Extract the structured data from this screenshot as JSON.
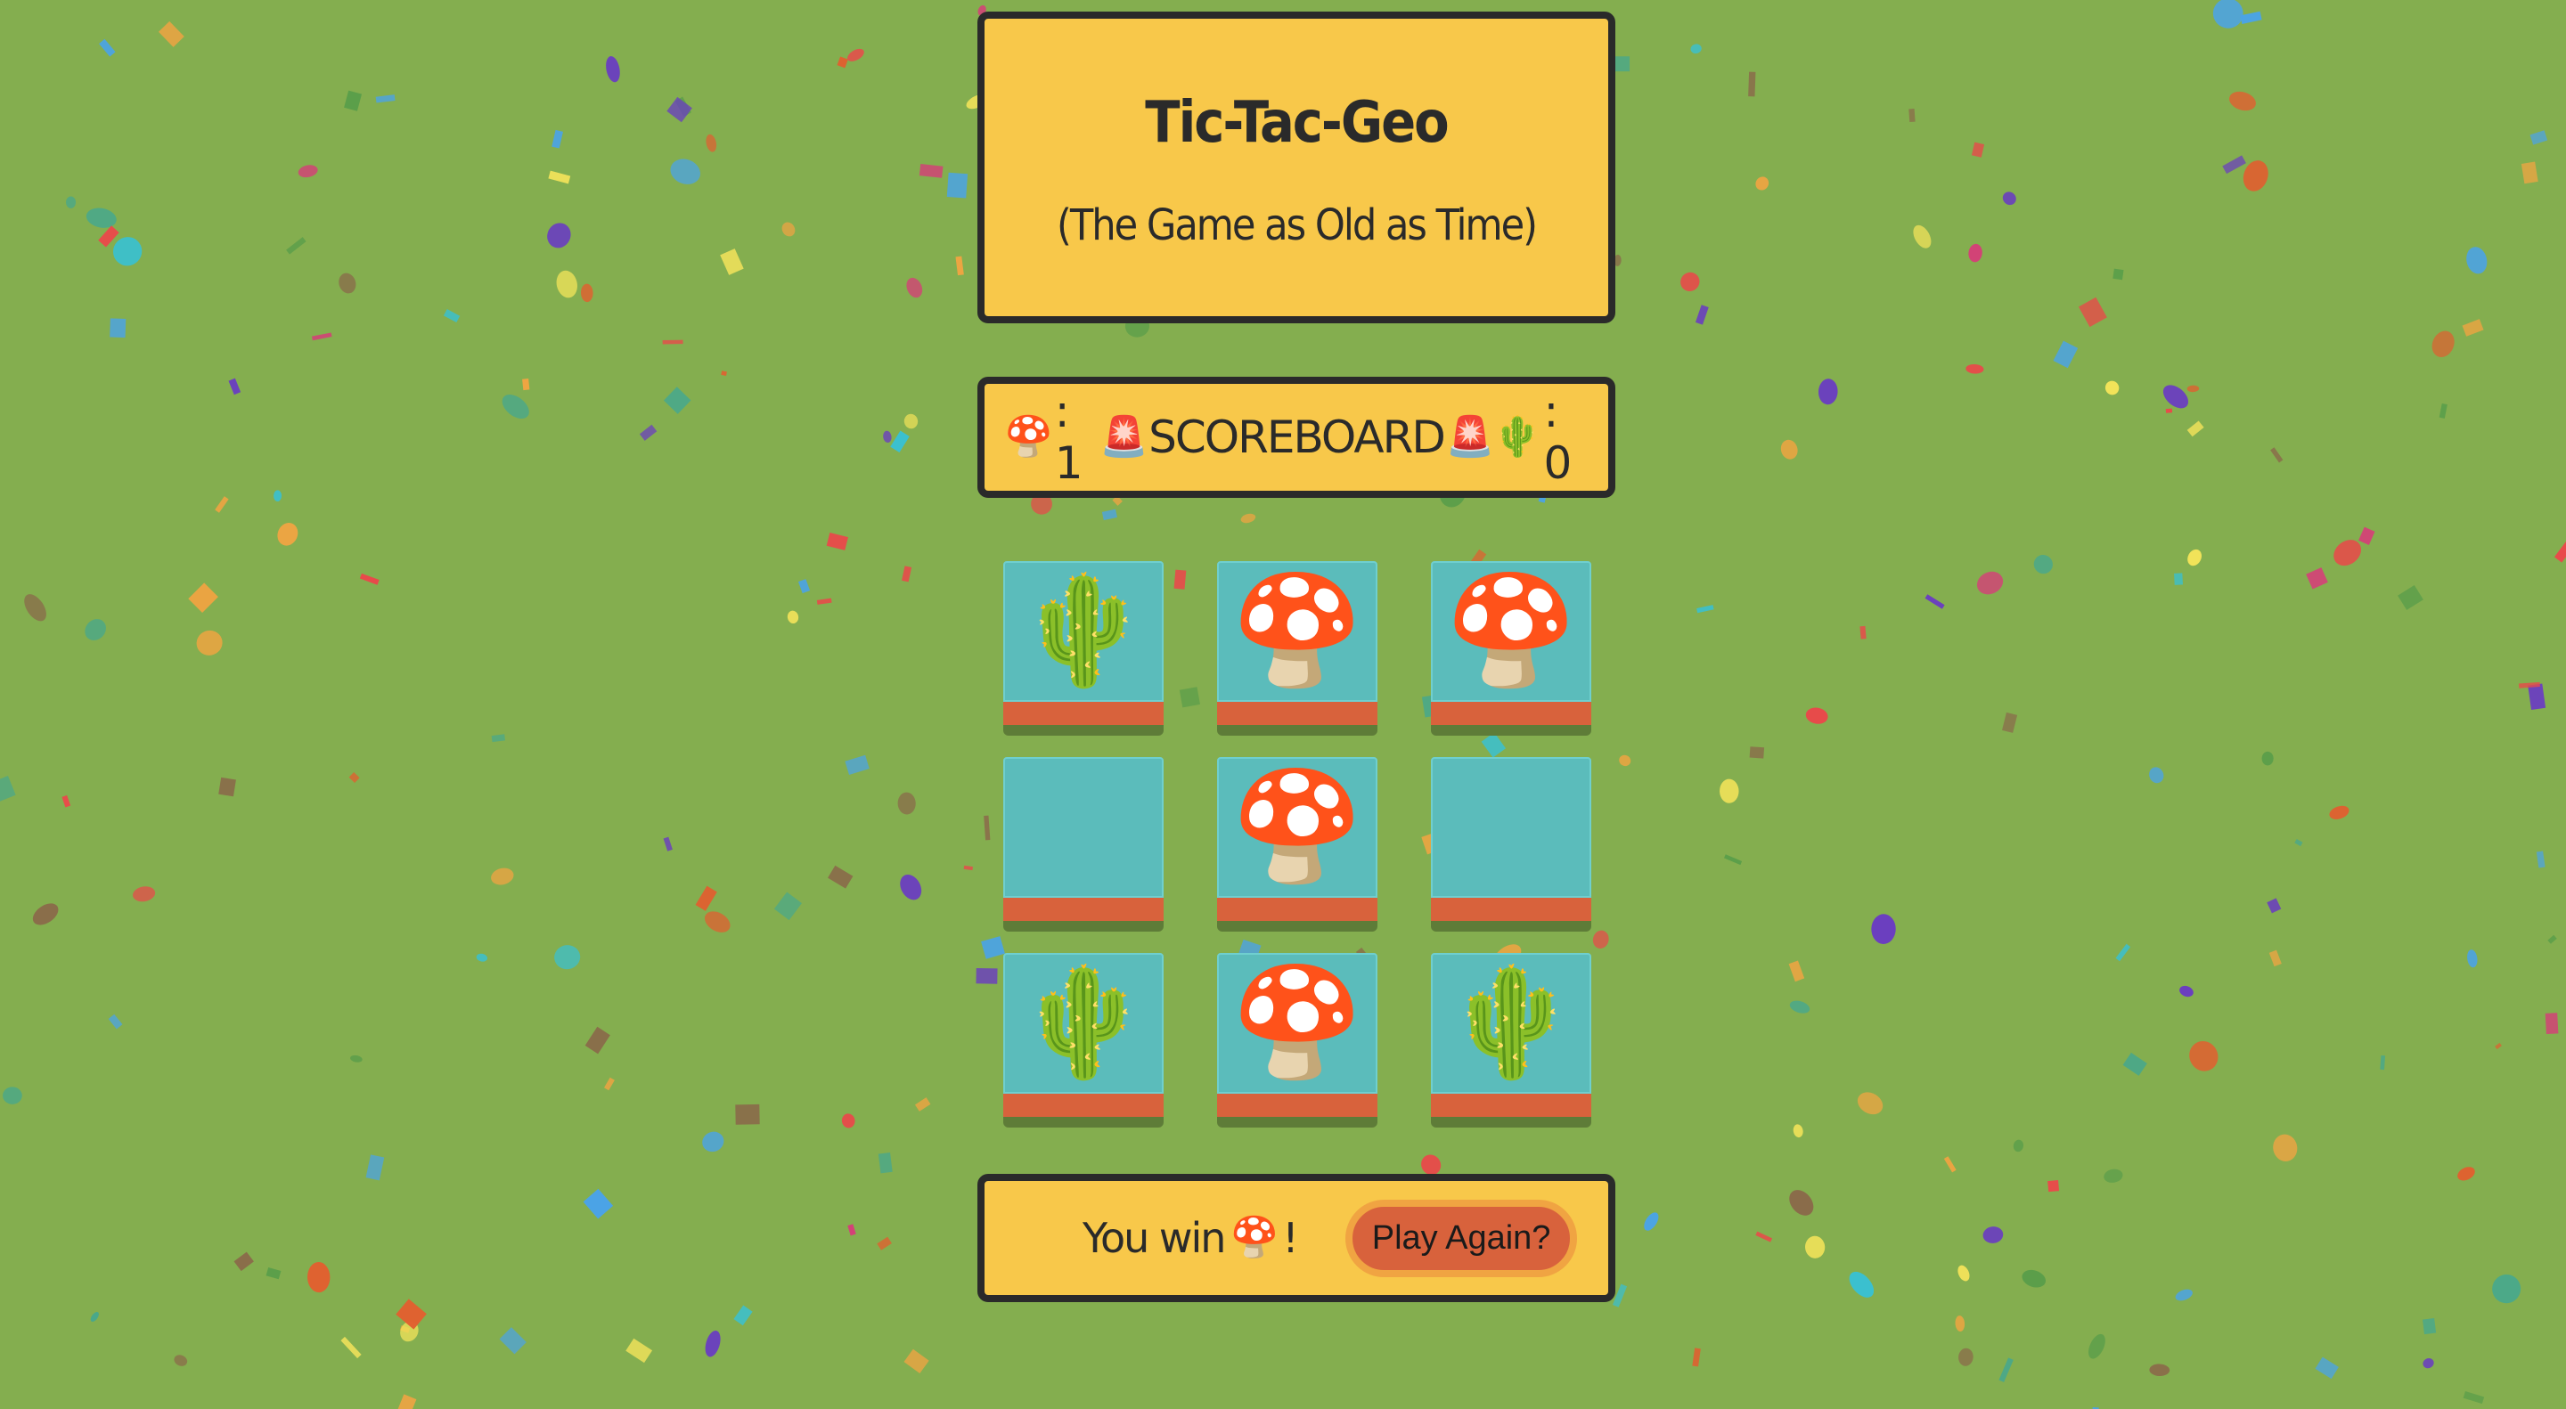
{
  "title": "Tic-Tac-Geo",
  "subtitle": "(The Game as Old as Time)",
  "scoreboard": {
    "player1": {
      "emoji": "🍄",
      "label": ": 1"
    },
    "center": {
      "left_emoji": "🚨",
      "text": "SCOREBOARD",
      "right_emoji": "🚨"
    },
    "player2": {
      "emoji": "🌵",
      "label": ": 0"
    }
  },
  "board": [
    [
      "🌵",
      "🍄",
      "🍄"
    ],
    [
      "",
      "🍄",
      ""
    ],
    [
      "🌵",
      "🍄",
      "🌵"
    ]
  ],
  "result": {
    "text": "You win ",
    "emoji": "🍄",
    "suffix": "!",
    "button_label": "Play Again?"
  },
  "colors": {
    "background": "#84ae4f",
    "panel": "#f8c84a",
    "tile": "#5bbcbb",
    "tile_edge": "#d8623c",
    "button": "#d8623c"
  }
}
